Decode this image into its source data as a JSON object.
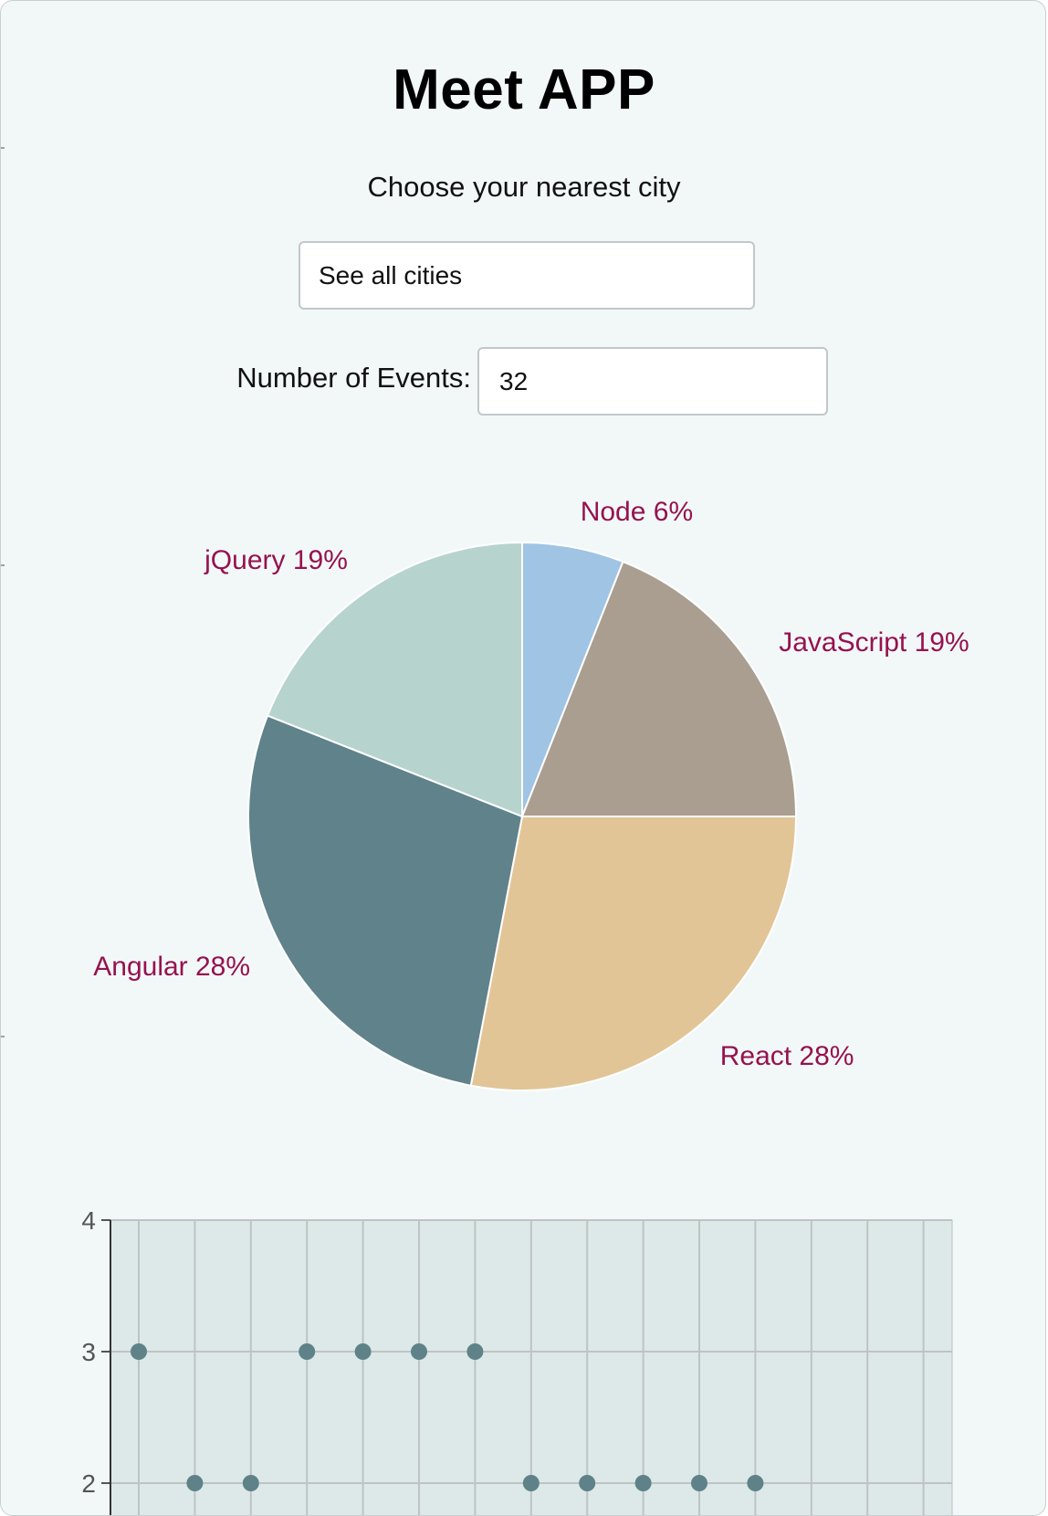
{
  "app": {
    "title": "Meet APP"
  },
  "city_search": {
    "label": "Choose your nearest city",
    "value": "See all cities",
    "placeholder": "See all cities"
  },
  "events": {
    "label": "Number of Events:",
    "value": "32"
  },
  "colors": {
    "background": "#f2f8f8",
    "label": "#96124f",
    "scatter_point": "#5f8289",
    "scatter_bg": "#dce9e8"
  },
  "chart_data": [
    {
      "type": "pie",
      "slices": [
        {
          "name": "React",
          "percent": 28,
          "label": "React 28%",
          "color": "#e2c597"
        },
        {
          "name": "Angular",
          "percent": 28,
          "label": "Angular 28%",
          "color": "#5f828b"
        },
        {
          "name": "jQuery",
          "percent": 19,
          "label": "jQuery 19%",
          "color": "#b7d3ce"
        },
        {
          "name": "Node",
          "percent": 6,
          "label": "Node 6%",
          "color": "#a0c4e4"
        },
        {
          "name": "JavaScript",
          "percent": 19,
          "label": "JavaScript 19%",
          "color": "#a99e90"
        }
      ]
    },
    {
      "type": "scatter",
      "ylim": [
        2,
        4
      ],
      "yticks": [
        "2",
        "3",
        "4"
      ],
      "x_count": 15,
      "grid": true,
      "points": [
        {
          "x": 1,
          "y": 3
        },
        {
          "x": 2,
          "y": 2
        },
        {
          "x": 3,
          "y": 2
        },
        {
          "x": 4,
          "y": 3
        },
        {
          "x": 5,
          "y": 3
        },
        {
          "x": 6,
          "y": 3
        },
        {
          "x": 7,
          "y": 3
        },
        {
          "x": 8,
          "y": 2
        },
        {
          "x": 9,
          "y": 2
        },
        {
          "x": 10,
          "y": 2
        },
        {
          "x": 11,
          "y": 2
        },
        {
          "x": 12,
          "y": 2
        }
      ]
    }
  ]
}
